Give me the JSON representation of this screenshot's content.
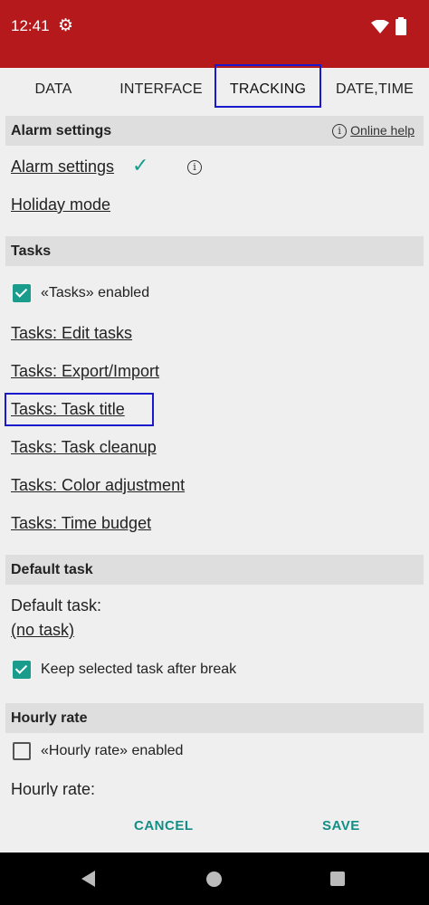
{
  "status": {
    "time": "12:41",
    "settings_icon": "gear-icon",
    "wifi_icon": "wifi-icon",
    "battery_icon": "battery-icon"
  },
  "tabs": [
    {
      "label": "DATA"
    },
    {
      "label": "INTERFACE"
    },
    {
      "label": "TRACKING"
    },
    {
      "label": "DATE,TIME"
    }
  ],
  "alarm": {
    "header": "Alarm settings",
    "help_icon": "i",
    "help_label": "Online help",
    "settings_link": "Alarm settings",
    "settings_check": "✓",
    "info_icon": "i",
    "holiday_link": "Holiday mode"
  },
  "tasks": {
    "header": "Tasks",
    "enabled_label": "«Tasks» enabled",
    "enabled_checked": true,
    "links": [
      "Tasks: Edit tasks",
      "Tasks: Export/Import",
      "Tasks: Task title",
      "Tasks: Task cleanup",
      "Tasks: Color adjustment",
      "Tasks: Time budget"
    ]
  },
  "default_task": {
    "header": "Default task",
    "label": "Default task:",
    "value": "(no task)",
    "keep_label": "Keep selected task after break",
    "keep_checked": true
  },
  "hourly": {
    "header": "Hourly rate",
    "enabled_label": "«Hourly rate» enabled",
    "enabled_checked": false,
    "rate_label": "Hourly rate:"
  },
  "footer": {
    "cancel": "CANCEL",
    "save": "SAVE"
  },
  "colors": {
    "status_bar": "#b5191b",
    "accent": "#1a9c8c",
    "highlight": "#1a1acc"
  }
}
